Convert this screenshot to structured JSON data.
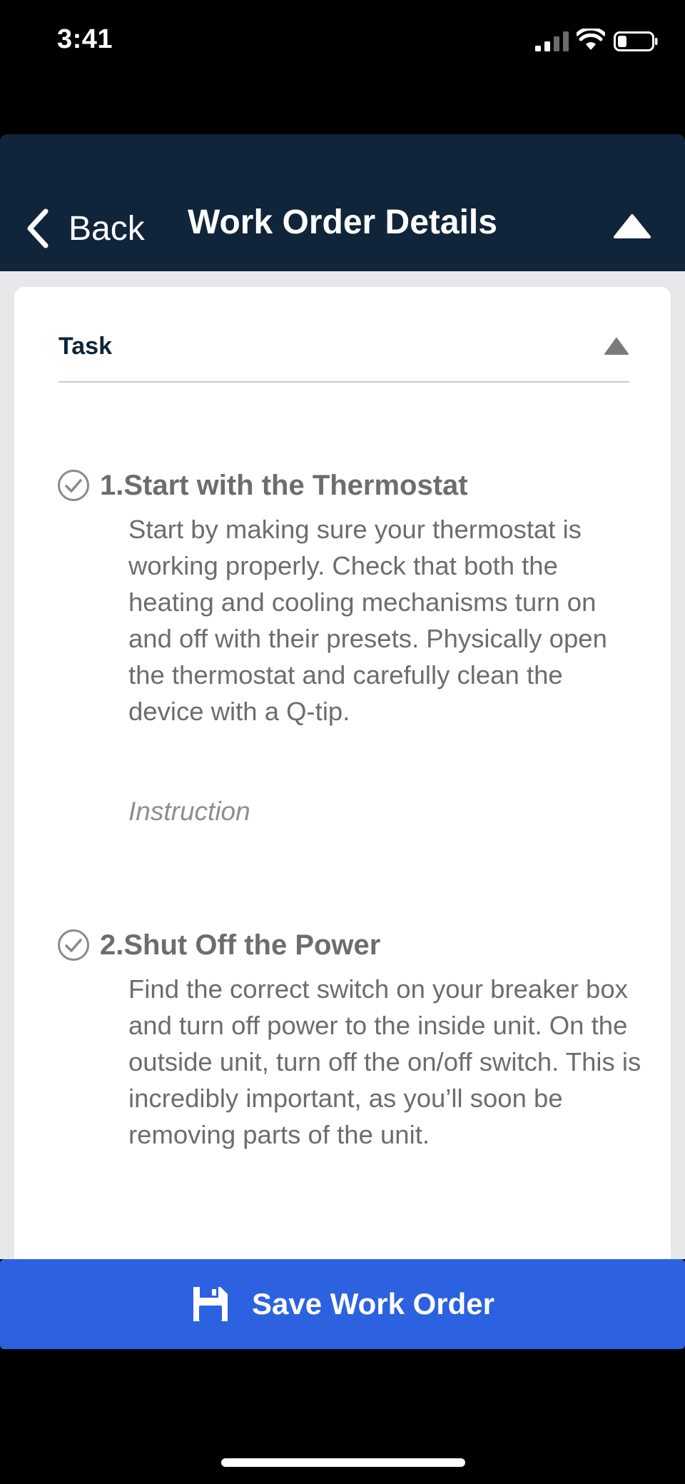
{
  "status_bar": {
    "time": "3:41",
    "icons": [
      "cellular-signal-icon",
      "wifi-icon",
      "battery-icon"
    ]
  },
  "header": {
    "back_label": "Back",
    "title": "Work Order Details",
    "collapse_icon": "triangle-up-icon"
  },
  "section": {
    "title": "Task",
    "caret_icon": "triangle-up-icon"
  },
  "tasks": [
    {
      "title": "1.Start with the Thermostat",
      "description": "Start by making sure your thermostat is working properly. Check that both the heating and cooling mechanisms turn on and off with their presets. Physically open the thermostat and carefully clean the device with a Q-tip.",
      "instruction_placeholder": "Instruction"
    },
    {
      "title": "2.Shut Off the Power",
      "description": "Find the correct switch on your breaker box and turn off power to the inside unit. On the outside unit, turn off the on/off switch. This is incredibly important, as you’ll soon be removing parts of the unit."
    }
  ],
  "footer": {
    "save_label": "Save Work Order",
    "save_icon": "floppy-disk-icon"
  },
  "colors": {
    "header_bg": "#10253a",
    "accent_button": "#2c62e0",
    "text_muted": "#6d6d70",
    "section_title": "#0f2538"
  }
}
